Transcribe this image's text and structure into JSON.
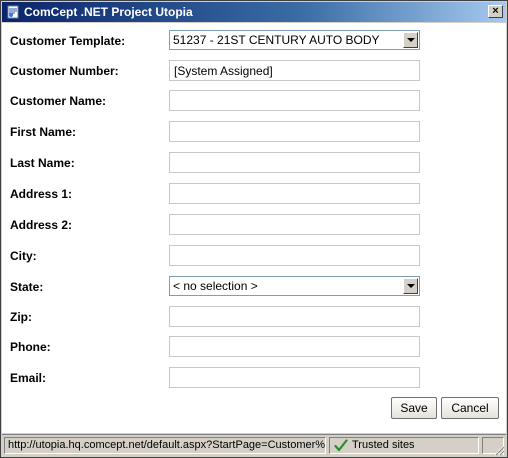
{
  "window": {
    "title": "ComCept .NET Project Utopia",
    "close_label": "×"
  },
  "form": {
    "fields": [
      {
        "label": "Customer Template:",
        "type": "select",
        "value": "51237 - 21ST CENTURY AUTO BODY"
      },
      {
        "label": "Customer Number:",
        "type": "text",
        "value": "[System Assigned]"
      },
      {
        "label": "Customer Name:",
        "type": "text",
        "value": ""
      },
      {
        "label": "First Name:",
        "type": "text",
        "value": ""
      },
      {
        "label": "Last Name:",
        "type": "text",
        "value": ""
      },
      {
        "label": "Address 1:",
        "type": "text",
        "value": ""
      },
      {
        "label": "Address 2:",
        "type": "text",
        "value": ""
      },
      {
        "label": "City:",
        "type": "text",
        "value": ""
      },
      {
        "label": "State:",
        "type": "select",
        "value": "< no selection >"
      },
      {
        "label": "Zip:",
        "type": "text",
        "value": ""
      },
      {
        "label": "Phone:",
        "type": "text",
        "value": ""
      },
      {
        "label": "Email:",
        "type": "text",
        "value": ""
      }
    ]
  },
  "buttons": {
    "save_label": "Save",
    "cancel_label": "Cancel"
  },
  "statusbar": {
    "url": "http://utopia.hq.comcept.net/default.aspx?StartPage=Customer%",
    "zone": "Trusted sites"
  },
  "colors": {
    "titlebar_start": "#0a246a",
    "titlebar_end": "#a6caf0",
    "trusted_check": "#2e8b2e"
  }
}
